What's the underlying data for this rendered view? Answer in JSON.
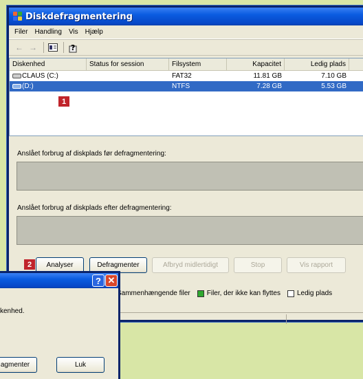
{
  "window": {
    "title": "Diskdefragmentering"
  },
  "menu": [
    "Filer",
    "Handling",
    "Vis",
    "Hjælp"
  ],
  "columns": [
    "Diskenhed",
    "Status for session",
    "Filsystem",
    "Kapacitet",
    "Ledig plads"
  ],
  "drives": [
    {
      "name": "CLAUS (C:)",
      "status": "",
      "fs": "FAT32",
      "capacity": "11.81 GB",
      "free": "7.10 GB",
      "selected": false
    },
    {
      "name": "(D:)",
      "status": "",
      "fs": "NTFS",
      "capacity": "7.28 GB",
      "free": "5.53 GB",
      "selected": true
    }
  ],
  "labels": {
    "before": "Anslået forbrug af diskplads før defragmentering:",
    "after": "Anslået forbrug af diskplads efter defragmentering:"
  },
  "buttons": {
    "analyze": "Analyser",
    "defrag": "Defragmenter",
    "pause": "Afbryd midlertidigt",
    "stop": "Stop",
    "report": "Vis rapport"
  },
  "badges": {
    "one": "1",
    "two": "2"
  },
  "legend": {
    "contiguous": "Sammenhængende filer",
    "unmovable": "Filer, der ikke kan flyttes",
    "free": "Ledig plads",
    "colors": {
      "contiguous": "#2b6ff0",
      "unmovable": "#2fa82f",
      "free": "#ffffff"
    }
  },
  "dialog": {
    "text": "kenhed.",
    "defrag_button": "agmenter",
    "close_button": "Luk"
  }
}
